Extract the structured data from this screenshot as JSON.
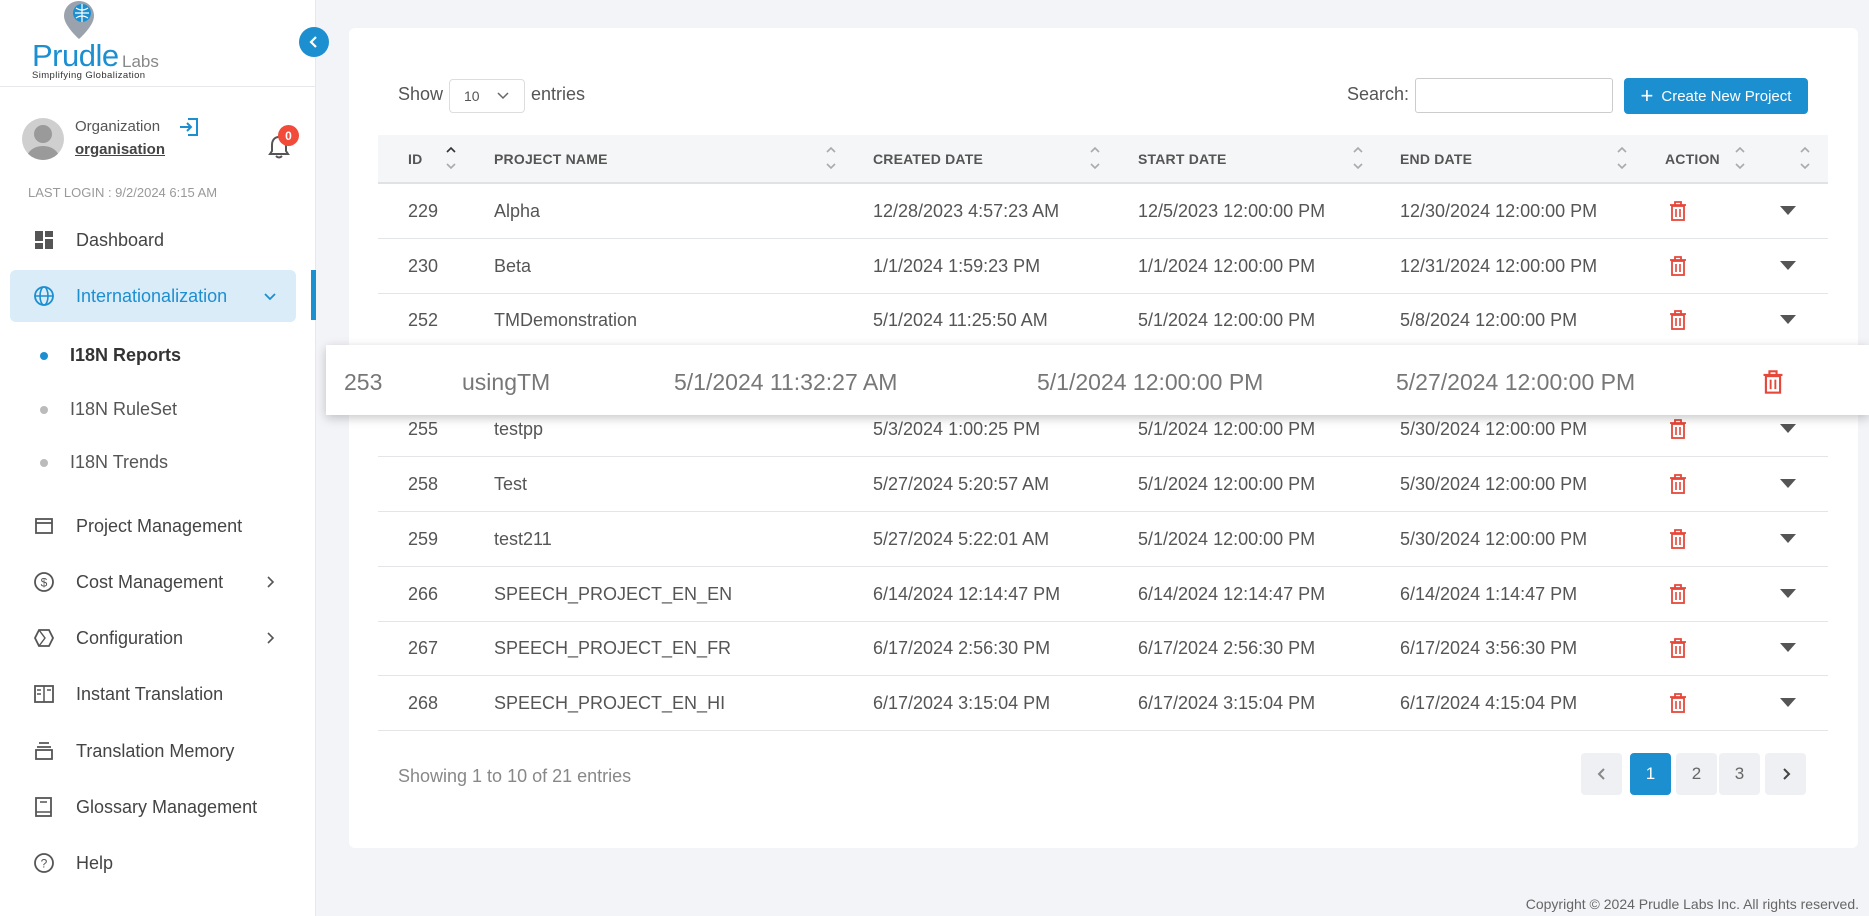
{
  "brand": {
    "name": "Prudle",
    "suffix": "Labs",
    "tagline": "Simplifying Globalization"
  },
  "user": {
    "name": "Organization",
    "org": "organisation",
    "notifications": "0",
    "last_login": "LAST LOGIN : 9/2/2024 6:15 AM"
  },
  "nav": {
    "dashboard": "Dashboard",
    "internationalization": "Internationalization",
    "sub": [
      "I18N Reports",
      "I18N RuleSet",
      "I18N Trends"
    ],
    "project_management": "Project Management",
    "cost_management": "Cost Management",
    "configuration": "Configuration",
    "instant_translation": "Instant Translation",
    "translation_memory": "Translation Memory",
    "glossary_management": "Glossary Management",
    "help": "Help"
  },
  "controls": {
    "show_label": "Show",
    "page_size": "10",
    "entries_label": "entries",
    "search_label": "Search:",
    "search_value": "",
    "create_button": "Create New Project"
  },
  "table": {
    "headers": [
      "ID",
      "PROJECT NAME",
      "CREATED DATE",
      "START DATE",
      "END DATE",
      "ACTION"
    ],
    "rows": [
      {
        "id": "229",
        "name": "Alpha",
        "created": "12/28/2023 4:57:23 AM",
        "start": "12/5/2023 12:00:00 PM",
        "end": "12/30/2024 12:00:00 PM"
      },
      {
        "id": "230",
        "name": "Beta",
        "created": "1/1/2024 1:59:23 PM",
        "start": "1/1/2024 12:00:00 PM",
        "end": "12/31/2024 12:00:00 PM"
      },
      {
        "id": "252",
        "name": "TMDemonstration",
        "created": "5/1/2024 11:25:50 AM",
        "start": "5/1/2024 12:00:00 PM",
        "end": "5/8/2024 12:00:00 PM"
      },
      {
        "id": "255",
        "name": "testpp",
        "created": "5/3/2024 1:00:25 PM",
        "start": "5/1/2024 12:00:00 PM",
        "end": "5/30/2024 12:00:00 PM"
      },
      {
        "id": "258",
        "name": "Test",
        "created": "5/27/2024 5:20:57 AM",
        "start": "5/1/2024 12:00:00 PM",
        "end": "5/30/2024 12:00:00 PM"
      },
      {
        "id": "259",
        "name": "test211",
        "created": "5/27/2024 5:22:01 AM",
        "start": "5/1/2024 12:00:00 PM",
        "end": "5/30/2024 12:00:00 PM"
      },
      {
        "id": "266",
        "name": "SPEECH_PROJECT_EN_EN",
        "created": "6/14/2024 12:14:47 PM",
        "start": "6/14/2024 12:14:47 PM",
        "end": "6/14/2024 1:14:47 PM"
      },
      {
        "id": "267",
        "name": "SPEECH_PROJECT_EN_FR",
        "created": "6/17/2024 2:56:30 PM",
        "start": "6/17/2024 2:56:30 PM",
        "end": "6/17/2024 3:56:30 PM"
      },
      {
        "id": "268",
        "name": "SPEECH_PROJECT_EN_HI",
        "created": "6/17/2024 3:15:04 PM",
        "start": "6/17/2024 3:15:04 PM",
        "end": "6/17/2024 4:15:04 PM"
      }
    ],
    "dragged_row": {
      "id": "253",
      "name": "usingTM",
      "created": "5/1/2024 11:32:27 AM",
      "start": "5/1/2024 12:00:00 PM",
      "end": "5/27/2024 12:00:00 PM"
    }
  },
  "footer": {
    "showing": "Showing 1 to 10 of 21 entries",
    "pages": [
      "1",
      "2",
      "3"
    ],
    "copyright": "Copyright © 2024 Prudle Labs Inc. All rights reserved."
  },
  "colors": {
    "accent": "#1c8fd1",
    "danger": "#e5483a",
    "badge": "#f24b3a"
  }
}
